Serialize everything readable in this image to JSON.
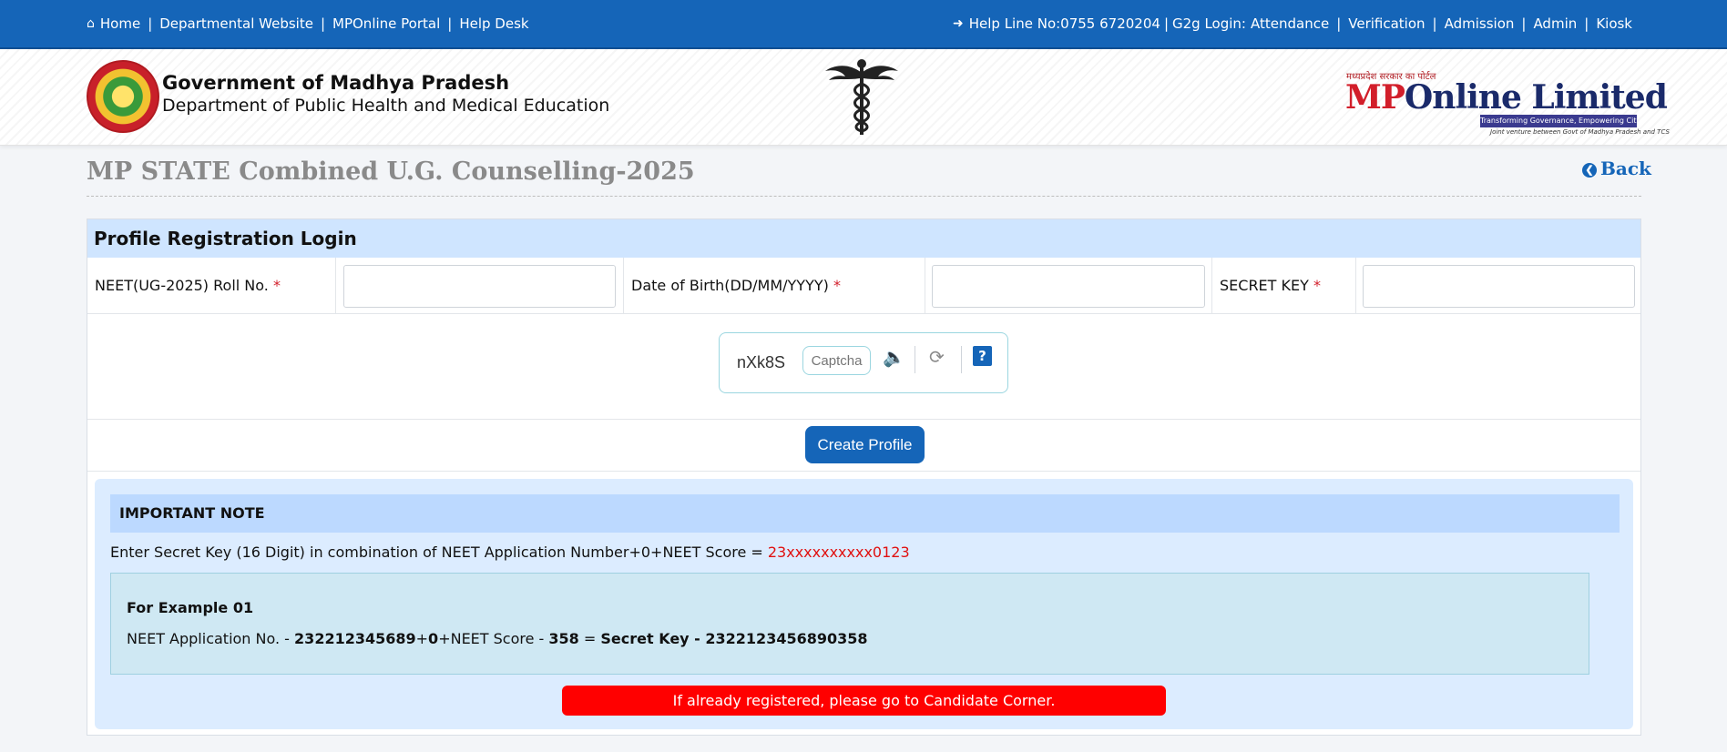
{
  "topbar": {
    "left_links": [
      {
        "label": "Home"
      },
      {
        "label": "Departmental Website"
      },
      {
        "label": "MPOnline Portal"
      },
      {
        "label": "Help Desk"
      }
    ],
    "helpline": "Help Line No:0755 6720204",
    "g2g_label": "G2g Login:",
    "right_links": [
      {
        "label": "Attendance"
      },
      {
        "label": "Verification"
      },
      {
        "label": "Admission"
      },
      {
        "label": "Admin"
      },
      {
        "label": "Kiosk"
      }
    ]
  },
  "header": {
    "org_line1": "Government of Madhya Pradesh",
    "org_line2": "Department of Public Health and Medical Education",
    "mponline_tagline": "मध्यप्रदेश सरकार का पोर्टल",
    "mponline_mp": "MP",
    "mponline_rest": "Online Limited",
    "mponline_strip": "Transforming Governance, Empowering Citizens",
    "mponline_sub": "Joint venture between Govt of Madhya Pradesh and TCS"
  },
  "page": {
    "title": "MP STATE Combined U.G. Counselling-2025",
    "back_label": "Back"
  },
  "form": {
    "heading": "Profile Registration Login",
    "roll_label": "NEET(UG-2025) Roll No.",
    "dob_label": "Date of Birth(DD/MM/YYYY)",
    "secret_label": "SECRET KEY",
    "required_mark": "*",
    "roll_value": "",
    "dob_value": "",
    "secret_value": ""
  },
  "captcha": {
    "text": "nXk8S",
    "placeholder": "Captcha",
    "help": "?"
  },
  "create_button": "Create Profile",
  "note": {
    "heading": "IMPORTANT NOTE",
    "line_prefix": "Enter Secret Key (16 Digit) in combination of NEET Application Number+0+NEET Score = ",
    "line_highlight": "23xxxxxxxxxx0123",
    "example_title": "For Example 01",
    "ex_part1": "NEET Application No. - ",
    "ex_app_no": "232212345689",
    "ex_plus": "+",
    "ex_zero": "0",
    "ex_part2": "+NEET Score - ",
    "ex_score": "358",
    "ex_eq": " = ",
    "ex_key": "Secret Key - 2322123456890358"
  },
  "alert": "If already registered, please go to Candidate Corner.",
  "colors": {
    "brand_blue": "#1565b8",
    "panel_head": "#cfe5ff",
    "alert_red": "#ff0000",
    "highlight_red": "#e01010"
  }
}
